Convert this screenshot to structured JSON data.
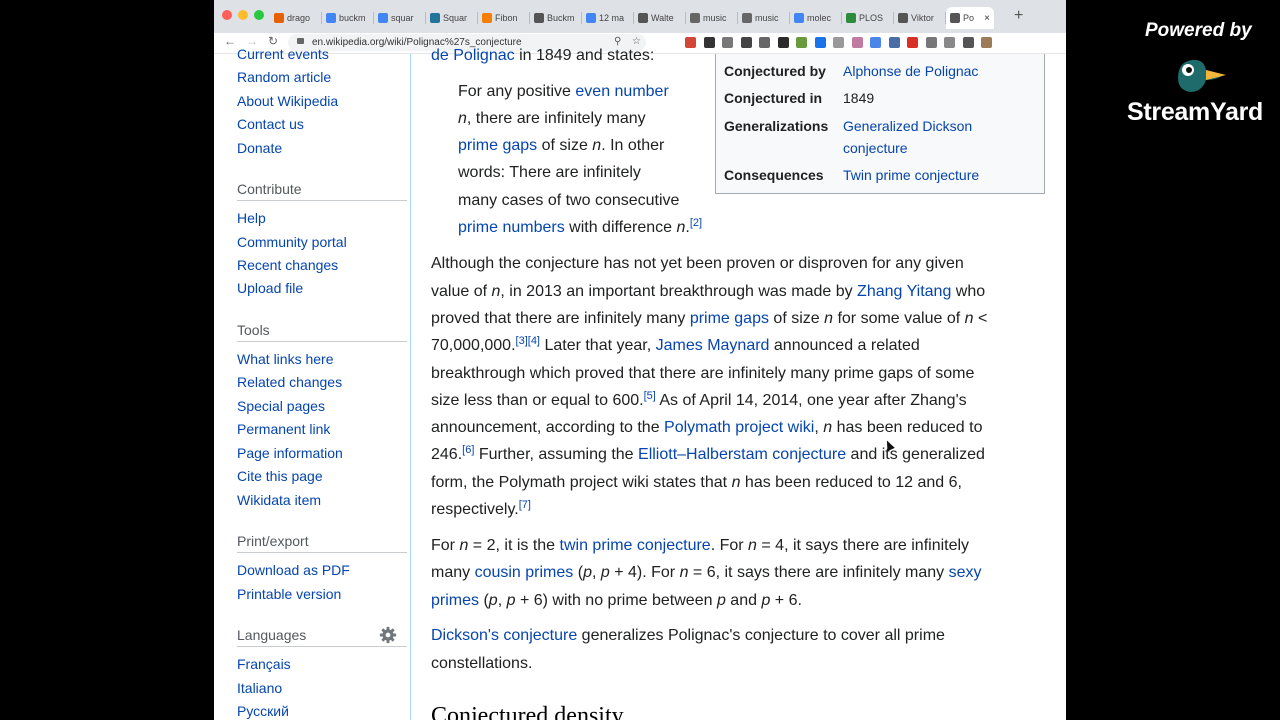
{
  "browser": {
    "tabs": [
      {
        "label": "drago",
        "favicon": "firefox-icon",
        "color": "#e66000"
      },
      {
        "label": "buckm",
        "favicon": "google-icon",
        "color": "#4285f4"
      },
      {
        "label": "squar",
        "favicon": "google-icon",
        "color": "#4285f4"
      },
      {
        "label": "Squar",
        "favicon": "wordpress-icon",
        "color": "#21759b"
      },
      {
        "label": "Fibon",
        "favicon": "blogger-icon",
        "color": "#f57d00"
      },
      {
        "label": "Buckm",
        "favicon": "wikipedia-icon",
        "color": "#555555"
      },
      {
        "label": "12 ma",
        "favicon": "google-icon",
        "color": "#4285f4"
      },
      {
        "label": "Walte",
        "favicon": "wikipedia-icon",
        "color": "#555555"
      },
      {
        "label": "music",
        "favicon": "globe-icon",
        "color": "#666666"
      },
      {
        "label": "music",
        "favicon": "globe-icon",
        "color": "#666666"
      },
      {
        "label": "molec",
        "favicon": "google-icon",
        "color": "#4285f4"
      },
      {
        "label": "PLOS",
        "favicon": "plos-icon",
        "color": "#2d8c3c"
      },
      {
        "label": "Viktor",
        "favicon": "wikipedia-icon",
        "color": "#555555"
      },
      {
        "label": "Po",
        "favicon": "wikipedia-icon",
        "color": "#555555",
        "active": true
      }
    ],
    "url": "en.wikipedia.org/wiki/Polignac%27s_conjecture",
    "extensions": [
      "#d44638",
      "#333333",
      "#777777",
      "#444444",
      "#666666",
      "#2b2b2b",
      "#6a9a3c",
      "#1a73e8",
      "#999999",
      "#c27ba0",
      "#4a86e8",
      "#4a6da7",
      "#d93025",
      "#777777",
      "#888888",
      "#555555",
      "#9e7b56"
    ]
  },
  "sidebar": {
    "nav": [
      {
        "label": "Current events"
      },
      {
        "label": "Random article"
      },
      {
        "label": "About Wikipedia"
      },
      {
        "label": "Contact us"
      },
      {
        "label": "Donate"
      }
    ],
    "contribute_heading": "Contribute",
    "contribute": [
      "Help",
      "Community portal",
      "Recent changes",
      "Upload file"
    ],
    "tools_heading": "Tools",
    "tools": [
      "What links here",
      "Related changes",
      "Special pages",
      "Permanent link",
      "Page information",
      "Cite this page",
      "Wikidata item"
    ],
    "print_heading": "Print/export",
    "print": [
      "Download as PDF",
      "Printable version"
    ],
    "languages_heading": "Languages",
    "languages": [
      "Français",
      "Italiano",
      "Русский"
    ]
  },
  "infobox": {
    "rows": [
      {
        "key": "Conjectured by",
        "value": "Alphonse de Polignac",
        "link": true
      },
      {
        "key": "Conjectured in",
        "value": "1849",
        "link": false
      },
      {
        "key": "Generalizations",
        "value": "Generalized Dickson",
        "value2": "conjecture",
        "link": true
      },
      {
        "key": "Consequences",
        "value": "Twin prime conjecture",
        "link": true
      }
    ]
  },
  "article": {
    "intro_link": "de Polignac",
    "intro_text": " in 1849 and states:",
    "quote": {
      "l1a": "For any positive ",
      "l1link": "even number",
      "l2a": "n",
      "l2b": ", there are infinitely many",
      "l3link": "prime gaps",
      "l3a": " of size ",
      "l3n": "n",
      "l3b": ". In other",
      "l4": "words: There are infinitely",
      "l5": "many cases of two consecutive",
      "l6link": "prime numbers",
      "l6a": " with difference ",
      "l6n": "n",
      "l6b": ".",
      "l6ref": "[2]"
    },
    "p1": {
      "l1": "Although the conjecture has not yet been proven or disproven for any given",
      "l2a": "value of ",
      "l2n": "n",
      "l2b": ", in 2013 an important breakthrough was made by ",
      "l2link": "Zhang Yitang",
      "l2c": " who",
      "l3a": "proved that there are infinitely many ",
      "l3link": "prime gaps",
      "l3b": " of size ",
      "l3n": "n",
      "l3c": " for some value of ",
      "l3n2": "n",
      "l3d": " <",
      "l4a": "70,000,000.",
      "l4ref": "[3][4]",
      "l4b": " Later that year, ",
      "l4link": "James Maynard",
      "l4c": " announced a related",
      "l5": "breakthrough which proved that there are infinitely many prime gaps of some",
      "l6a": "size less than or equal to 600.",
      "l6ref": "[5]",
      "l6b": " As of April 14, 2014, one year after Zhang's",
      "l7a": "announcement, according to the ",
      "l7link": "Polymath project wiki",
      "l7b": ", ",
      "l7n": "n",
      "l7c": " has been reduced to",
      "l8a": "246.",
      "l8ref": "[6]",
      "l8b": " Further, assuming the ",
      "l8link": "Elliott–Halberstam conjecture",
      "l8c": " and its generalized",
      "l9a": "form, the Polymath project wiki states that ",
      "l9n": "n",
      "l9b": " has been reduced to 12 and 6,",
      "l10a": "respectively.",
      "l10ref": "[7]"
    },
    "p2": {
      "l1a": "For ",
      "l1n": "n",
      "l1b": " = 2, it is the ",
      "l1link": "twin prime conjecture",
      "l1c": ". For ",
      "l1n2": "n",
      "l1d": " = 4, it says there are infinitely",
      "l2a": "many ",
      "l2link": "cousin primes",
      "l2b": " (",
      "l2p": "p",
      "l2c": ", ",
      "l2p2": "p",
      "l2d": " + 4). For ",
      "l2n": "n",
      "l2e": " = 6, it says there are infinitely many ",
      "l2link2": "sexy",
      "l3link": "primes",
      "l3a": " (",
      "l3p": "p",
      "l3b": ", ",
      "l3p2": "p",
      "l3c": " + 6) with no prime between ",
      "l3p3": "p",
      "l3d": " and ",
      "l3p4": "p",
      "l3e": " + 6."
    },
    "p3": {
      "l1link": "Dickson's conjecture",
      "l1a": " generalizes Polignac's conjecture to cover all prime",
      "l2": "constellations."
    },
    "heading": "Conjectured density"
  },
  "overlay": {
    "powered_by": "Powered by",
    "brand": "StreamYard"
  }
}
